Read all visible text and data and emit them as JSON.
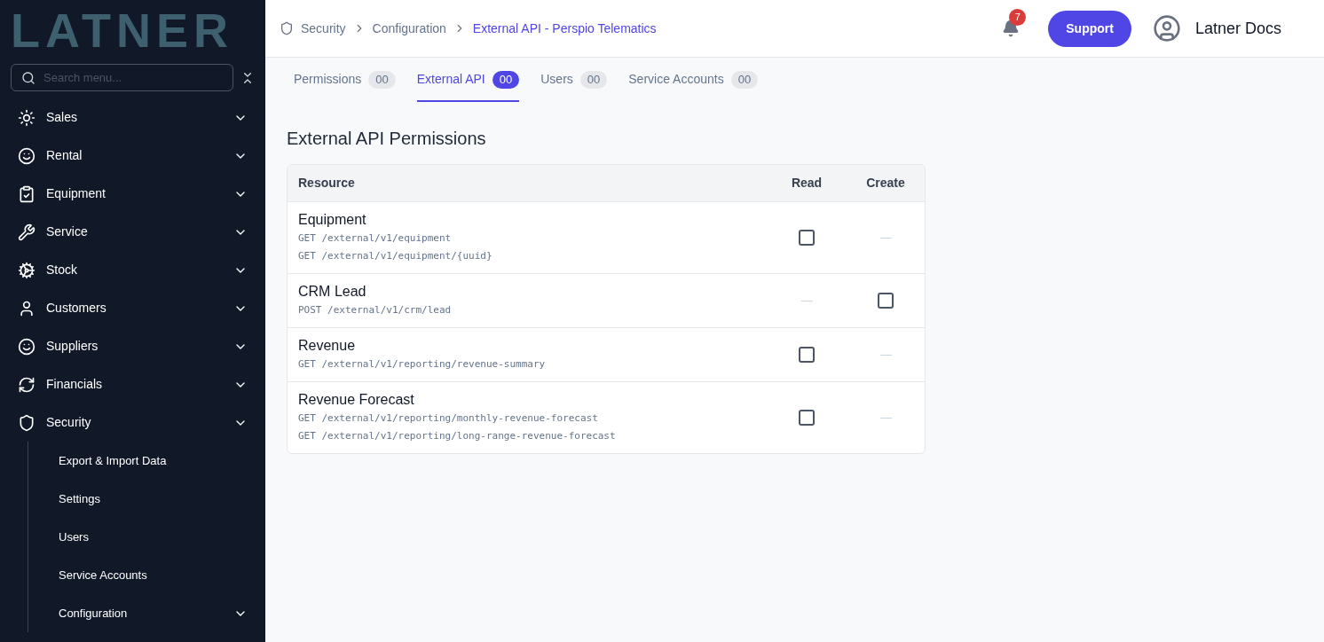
{
  "logo": {
    "text": "LATNER"
  },
  "sidebar": {
    "search": {
      "placeholder": "Search menu..."
    },
    "items": [
      {
        "label": "Sales"
      },
      {
        "label": "Rental"
      },
      {
        "label": "Equipment"
      },
      {
        "label": "Service"
      },
      {
        "label": "Stock"
      },
      {
        "label": "Customers"
      },
      {
        "label": "Suppliers"
      },
      {
        "label": "Financials"
      },
      {
        "label": "Security",
        "children": [
          {
            "label": "Export & Import Data",
            "kind": "link"
          },
          {
            "label": "Settings",
            "kind": "link"
          },
          {
            "label": "Users",
            "kind": "link"
          },
          {
            "label": "Service Accounts",
            "kind": "link"
          },
          {
            "label": "Configuration",
            "kind": "group"
          }
        ]
      }
    ]
  },
  "breadcrumb": [
    {
      "label": "Security",
      "selected": false
    },
    {
      "label": "Configuration",
      "selected": false
    },
    {
      "label": "External API - Perspio Telematics",
      "selected": true
    }
  ],
  "header": {
    "notifications": "7",
    "support": "Support",
    "user": "Latner Docs"
  },
  "tabs": [
    {
      "label": "Permissions",
      "count": "00",
      "selected": false
    },
    {
      "label": "External API",
      "count": "00",
      "selected": true
    },
    {
      "label": "Users",
      "count": "00",
      "selected": false
    },
    {
      "label": "Service Accounts",
      "count": "00",
      "selected": false
    }
  ],
  "section_title": "External API Permissions",
  "table": {
    "columns": [
      "Resource",
      "Read",
      "Create"
    ],
    "rows": [
      {
        "name": "Equipment",
        "endpoints": [
          "GET /external/v1/equipment",
          "GET /external/v1/equipment/{uuid}"
        ],
        "cells": [
          {
            "kind": "checkbox",
            "checked": false
          },
          {
            "kind": "none"
          }
        ]
      },
      {
        "name": "CRM Lead",
        "endpoints": [
          "POST /external/v1/crm/lead"
        ],
        "cells": [
          {
            "kind": "none"
          },
          {
            "kind": "checkbox",
            "checked": false
          }
        ]
      },
      {
        "name": "Revenue",
        "endpoints": [
          "GET /external/v1/reporting/revenue-summary"
        ],
        "cells": [
          {
            "kind": "checkbox",
            "checked": false
          },
          {
            "kind": "none"
          }
        ]
      },
      {
        "name": "Revenue Forecast",
        "endpoints": [
          "GET /external/v1/reporting/monthly-revenue-forecast",
          "GET /external/v1/reporting/long-range-revenue-forecast"
        ],
        "cells": [
          {
            "kind": "checkbox",
            "checked": false
          },
          {
            "kind": "none"
          }
        ]
      }
    ]
  }
}
